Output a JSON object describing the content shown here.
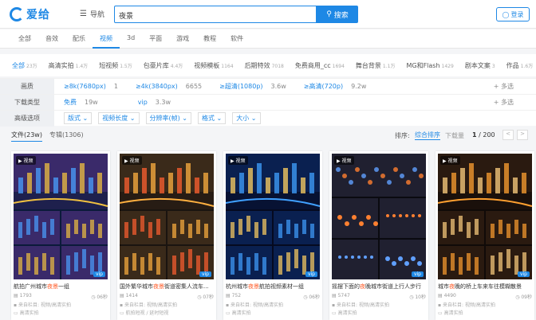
{
  "header": {
    "logo_text": "爱给",
    "nav_label": "导航",
    "search_value": "夜景",
    "search_button": "搜索",
    "login_label": "登录"
  },
  "categories": [
    "全部",
    "音效",
    "配乐",
    "视频",
    "3d",
    "平面",
    "游戏",
    "教程",
    "软件"
  ],
  "active_category": "视频",
  "subtabs": [
    {
      "label": "全部",
      "count": "23万"
    },
    {
      "label": "高清实拍",
      "count": "1.4万"
    },
    {
      "label": "短视频",
      "count": "1.5万"
    },
    {
      "label": "包豪片库",
      "count": "4.4万"
    },
    {
      "label": "视频模板",
      "count": "1164"
    },
    {
      "label": "后期特效",
      "count": "7018"
    },
    {
      "label": "免费商用_cc",
      "count": "1694"
    },
    {
      "label": "舞台背景",
      "count": "1.1万"
    },
    {
      "label": "MG和Flash",
      "count": "1429"
    },
    {
      "label": "剧本文案",
      "count": "3"
    },
    {
      "label": "作品",
      "count": "1.6万"
    }
  ],
  "filters": {
    "quality": {
      "label": "画质",
      "options": [
        {
          "text": "≥8k(7680px)",
          "count": "1"
        },
        {
          "text": "≥4k(3840px)",
          "count": "6655"
        },
        {
          "text": "≥超清(1080p)",
          "count": "3.6w"
        },
        {
          "text": "≥高清(720p)",
          "count": "9.2w"
        }
      ],
      "more": "+ 多选"
    },
    "download": {
      "label": "下载类型",
      "options": [
        {
          "text": "免费",
          "count": "19w"
        },
        {
          "text": "vip",
          "count": "3.3w"
        }
      ],
      "more": "+ 多选"
    },
    "advanced": {
      "label": "高级选项",
      "selects": [
        "版式",
        "视频长度",
        "分辨率(帧)",
        "格式",
        "大小"
      ]
    }
  },
  "results": {
    "tab_files": "文件(23w)",
    "tab_albums": "专辑(1306)",
    "sort_label": "排序:",
    "sort_active": "综合排序",
    "sort_other": "下载量",
    "page": "1",
    "page_total": "/ 200",
    "prev": "<",
    "next": ">"
  },
  "cards": [
    {
      "badge": "视频",
      "title_pre": "航拍广州城市",
      "title_hl": "夜景",
      "title_post": "一组",
      "views": "1793",
      "dur": "06秒",
      "col": "来自栏目:",
      "col2": "视频/高清实拍",
      "tag": "高清实拍",
      "vip": "vip"
    },
    {
      "badge": "视频",
      "title_pre": "国外繁华城市",
      "title_hl": "夜景",
      "title_post": "街道密集人流车...",
      "views": "1414",
      "dur": "07秒",
      "col": "来自栏目:",
      "col2": "视频/高清实拍",
      "tag": "航拍短视 / 延时短视",
      "vip": "vip"
    },
    {
      "badge": "视频",
      "title_pre": "杭州城市",
      "title_hl": "夜景",
      "title_post": "航拍视频素材一组",
      "views": "752",
      "dur": "06秒",
      "col": "来自栏目:",
      "col2": "视频/高清实拍",
      "tag": "高清实拍",
      "vip": "vip"
    },
    {
      "badge": "视频",
      "title_pre": "摇摆下面的",
      "title_hl": "夜",
      "title_post": "晚城市街道上行人步行",
      "views": "5747",
      "dur": "10秒",
      "col": "来自栏目:",
      "col2": "视频/高清实拍",
      "tag": "高清实拍",
      "vip": "vip"
    },
    {
      "badge": "视频",
      "title_pre": "城市",
      "title_hl": "夜",
      "title_post": "晚的桥上车来车往模糊散景",
      "views": "4490",
      "dur": "09秒",
      "col": "来自栏目:",
      "col2": "视频/高清实拍",
      "tag": "高清实拍",
      "vip": "vip"
    }
  ]
}
